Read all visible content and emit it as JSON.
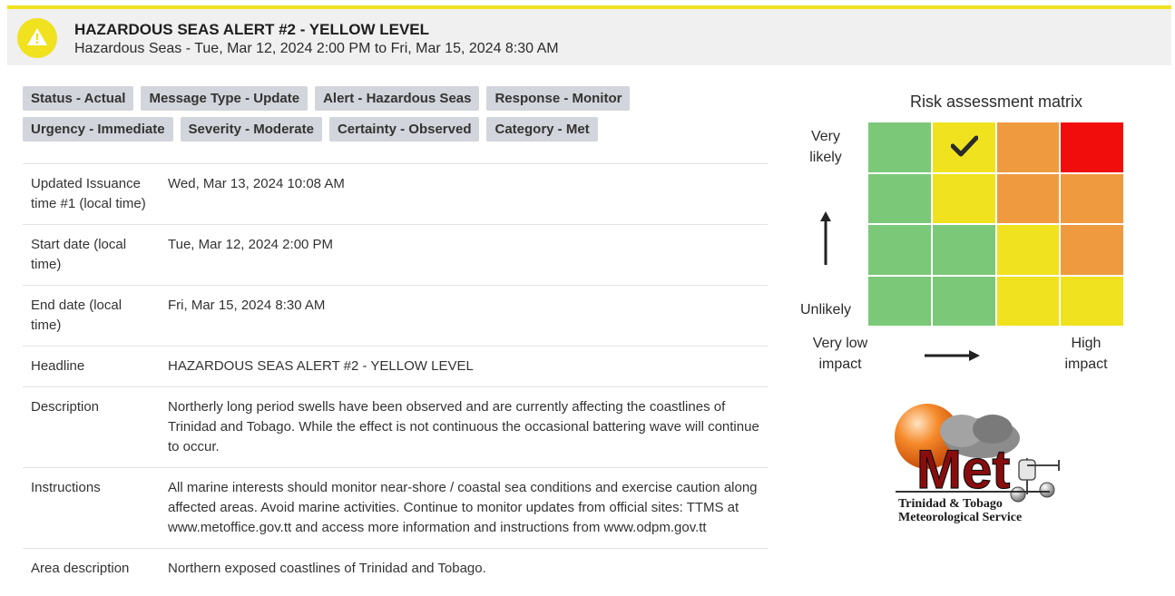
{
  "alert": {
    "title": "HAZARDOUS SEAS ALERT #2 - YELLOW LEVEL",
    "subtitle": "Hazardous Seas - Tue, Mar 12, 2024 2:00 PM to Fri, Mar 15, 2024 8:30 AM",
    "icon": "warning-icon",
    "color": "#f0e21e"
  },
  "tags": {
    "row1": [
      "Status - Actual",
      "Message Type - Update",
      "Alert - Hazardous Seas",
      "Response - Monitor"
    ],
    "row2": [
      "Urgency - Immediate",
      "Severity - Moderate",
      "Certainty - Observed",
      "Category - Met"
    ]
  },
  "details": [
    {
      "label": "Updated Issuance time #1 (local time)",
      "value": "Wed, Mar 13, 2024 10:08 AM"
    },
    {
      "label": "Start date (local time)",
      "value": "Tue, Mar 12, 2024 2:00 PM"
    },
    {
      "label": "End date (local time)",
      "value": "Fri, Mar 15, 2024 8:30 AM"
    },
    {
      "label": "Headline",
      "value": "HAZARDOUS SEAS ALERT #2 - YELLOW LEVEL"
    },
    {
      "label": "Description",
      "value": "Northerly long period swells have been observed and are currently affecting the coastlines of Trinidad and Tobago. While the effect is not continuous the occasional battering wave will continue to occur."
    },
    {
      "label": "Instructions",
      "value": "All marine interests should monitor near-shore / coastal sea conditions and exercise caution along affected areas. Avoid marine activities. Continue to monitor updates from official sites: TTMS at www.metoffice.gov.tt and access more information and instructions from www.odpm.gov.tt"
    },
    {
      "label": "Area description",
      "value": "Northern exposed coastlines of Trinidad and Tobago."
    }
  ],
  "matrix": {
    "title": "Risk assessment matrix",
    "y_top": "Very likely",
    "y_bottom": "Unlikely",
    "x_left": "Very low impact",
    "x_right": "High impact",
    "colors": {
      "green": "#7cc879",
      "yellow": "#f0e21e",
      "orange": "#f09a3f",
      "red": "#f20d0d"
    },
    "cells": [
      [
        "green",
        "yellow",
        "orange",
        "red"
      ],
      [
        "green",
        "yellow",
        "orange",
        "orange"
      ],
      [
        "green",
        "green",
        "yellow",
        "orange"
      ],
      [
        "green",
        "green",
        "yellow",
        "yellow"
      ]
    ],
    "selected": {
      "row": 0,
      "col": 1
    },
    "check_icon": "checkmark-icon"
  },
  "logo": {
    "word": "Met",
    "line1": "Trinidad & Tobago",
    "line2": "Meteorological Service"
  }
}
